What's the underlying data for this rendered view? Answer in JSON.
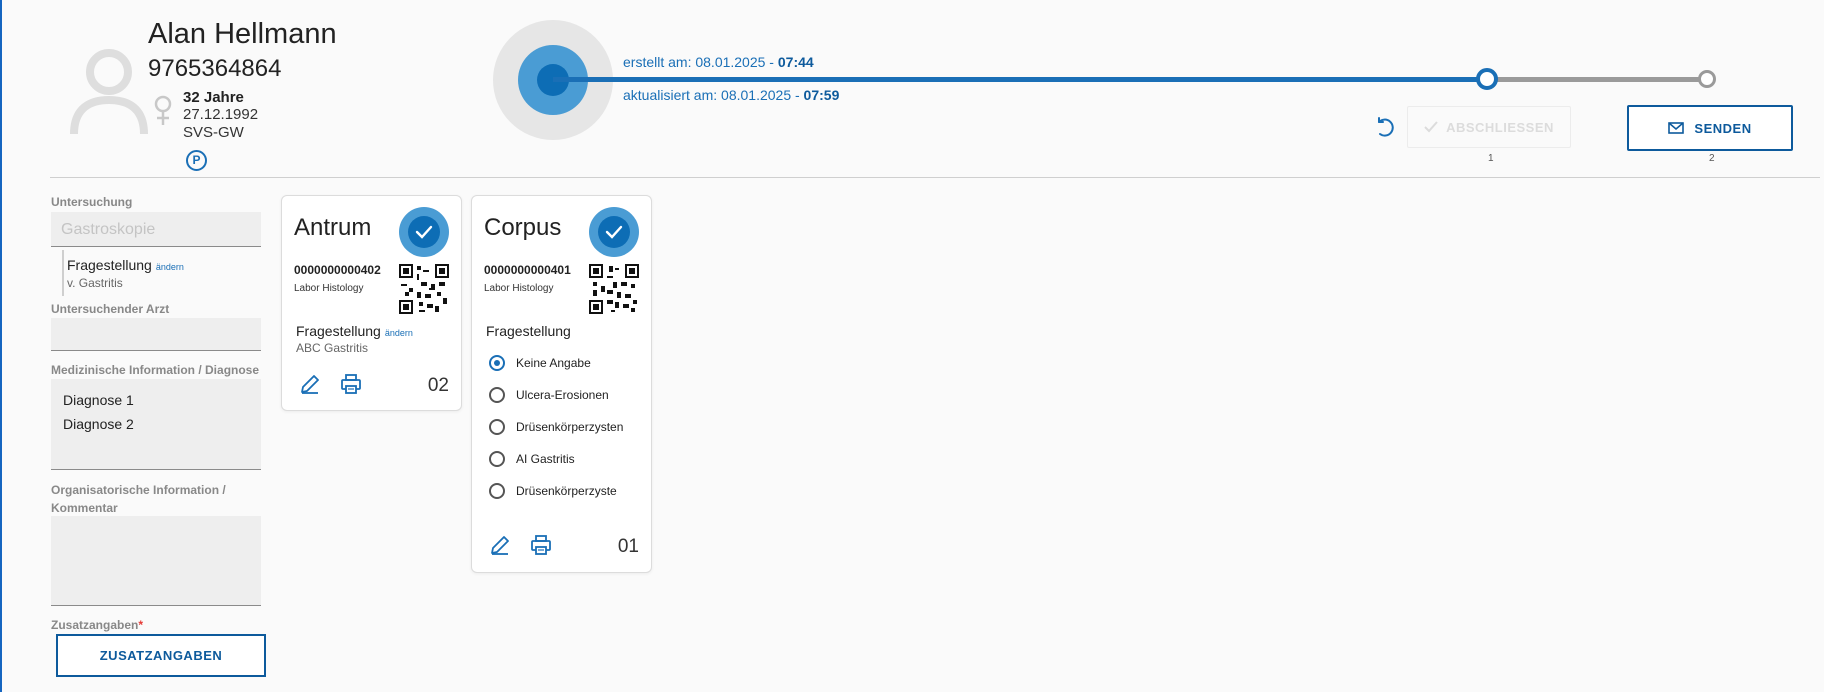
{
  "patient": {
    "name": "Alan Hellmann",
    "number": "9765364864",
    "age": "32 Jahre",
    "birthdate": "27.12.1992",
    "insurance": "SVS-GW",
    "badge": "P"
  },
  "timeline": {
    "created_label": "erstellt am: 08.01.2025 - ",
    "created_time": "07:44",
    "updated_label": "aktualisiert am: 08.01.2025 - ",
    "updated_time": "07:59",
    "step1": "1",
    "step2": "2"
  },
  "actions": {
    "close_label": "ABSCHLIESSEN",
    "send_label": "SENDEN"
  },
  "form": {
    "examination_label": "Untersuchung",
    "examination_value": "Gastroskopie",
    "question_label": "Fragestellung",
    "question_change": "ändern",
    "question_value": "v. Gastritis",
    "doctor_label": "Untersuchender Arzt",
    "medical_label": "Medizinische Information / Diagnose",
    "diagnoses": [
      "Diagnose 1",
      "Diagnose 2"
    ],
    "org_label": "Organisatorische Information / Kommentar",
    "extra_label": "Zusatzangaben",
    "required_mark": "*",
    "extra_button": "ZUSATZANGABEN"
  },
  "cards": [
    {
      "title": "Antrum",
      "code": "0000000000402",
      "lab": "Labor Histology",
      "question_label": "Fragestellung",
      "question_change": "ändern",
      "question_value": "ABC Gastritis",
      "number": "02"
    },
    {
      "title": "Corpus",
      "code": "0000000000401",
      "lab": "Labor Histology",
      "question_label": "Fragestellung",
      "options": [
        "Keine Angabe",
        "Ulcera-Erosionen",
        "Drüsenkörperzysten",
        "AI Gastritis",
        "Drüsenkörperzyste"
      ],
      "selected_option": "Keine Angabe",
      "number": "01"
    }
  ],
  "colors": {
    "accent": "#1a6fb6",
    "accent_dark": "#0d5a9c",
    "check_outer": "#4a9cd4",
    "required": "#e53935"
  },
  "icons": {
    "avatar": "person-icon",
    "gender": "female-icon",
    "undo": "undo-icon",
    "check": "check-icon",
    "send": "mail-icon",
    "edit": "pencil-icon",
    "print": "printer-icon",
    "qr": "qr-code-icon"
  }
}
